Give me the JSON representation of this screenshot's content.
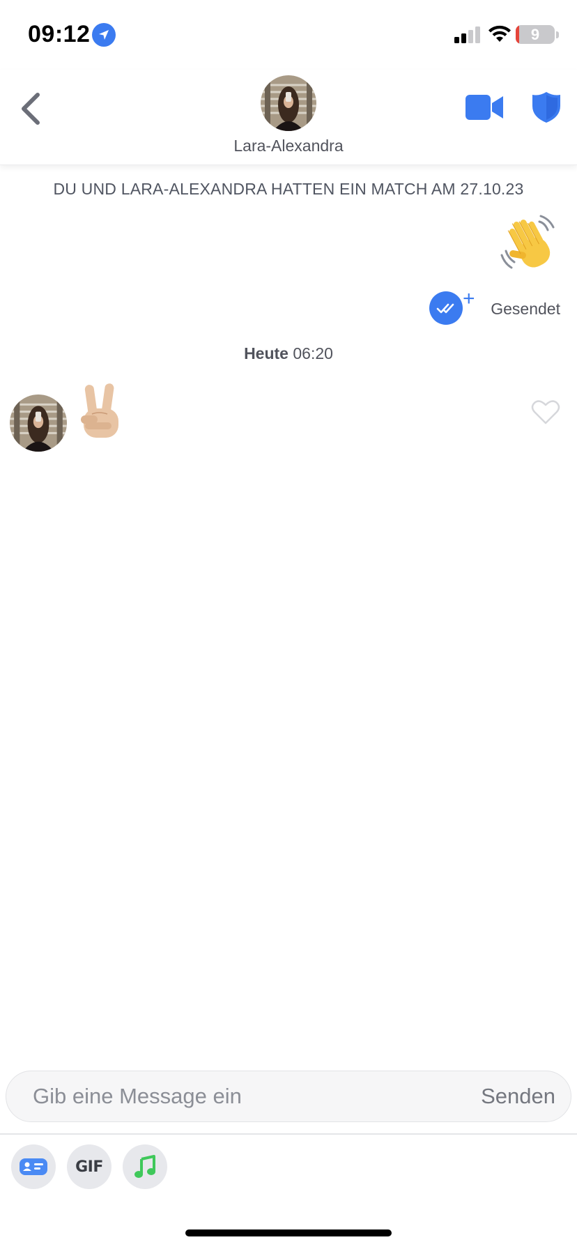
{
  "status_bar": {
    "time": "09:12",
    "battery_level": "9",
    "icons": [
      "location-arrow-icon",
      "cellular-signal-icon",
      "wifi-icon",
      "battery-icon"
    ],
    "signal_bars": "2 of 4",
    "battery_fill_percent": 9
  },
  "header": {
    "back_icon": "chevron-left-icon",
    "contact_name": "Lara-Alexandra",
    "video_icon": "video-camera-icon",
    "safety_icon": "shield-icon"
  },
  "conversation": {
    "match_info": "DU UND LARA-ALEXANDRA HATTEN EIN MATCH AM 27.10.23",
    "sent_message": {
      "emoji_icon": "waving-hand-emoji",
      "receipt_icon": "double-check-icon",
      "receipt_plus": "+",
      "status": "Gesendet"
    },
    "timestamp": {
      "day": "Heute",
      "time": "06:20"
    },
    "received_message": {
      "emoji_icon": "victory-hand-emoji",
      "like_icon": "heart-outline-icon"
    }
  },
  "composer": {
    "placeholder": "Gib eine Message ein",
    "send_label": "Senden",
    "tools": [
      {
        "name": "contact-card-button",
        "icon": "contact-card-icon"
      },
      {
        "name": "gif-button",
        "label": "GIF"
      },
      {
        "name": "music-button",
        "icon": "music-note-icon"
      }
    ]
  },
  "colors": {
    "accent_blue": "#3b7bf0",
    "text_gray": "#51535c",
    "music_green": "#3fc85a",
    "battery_red": "#e5443a"
  }
}
